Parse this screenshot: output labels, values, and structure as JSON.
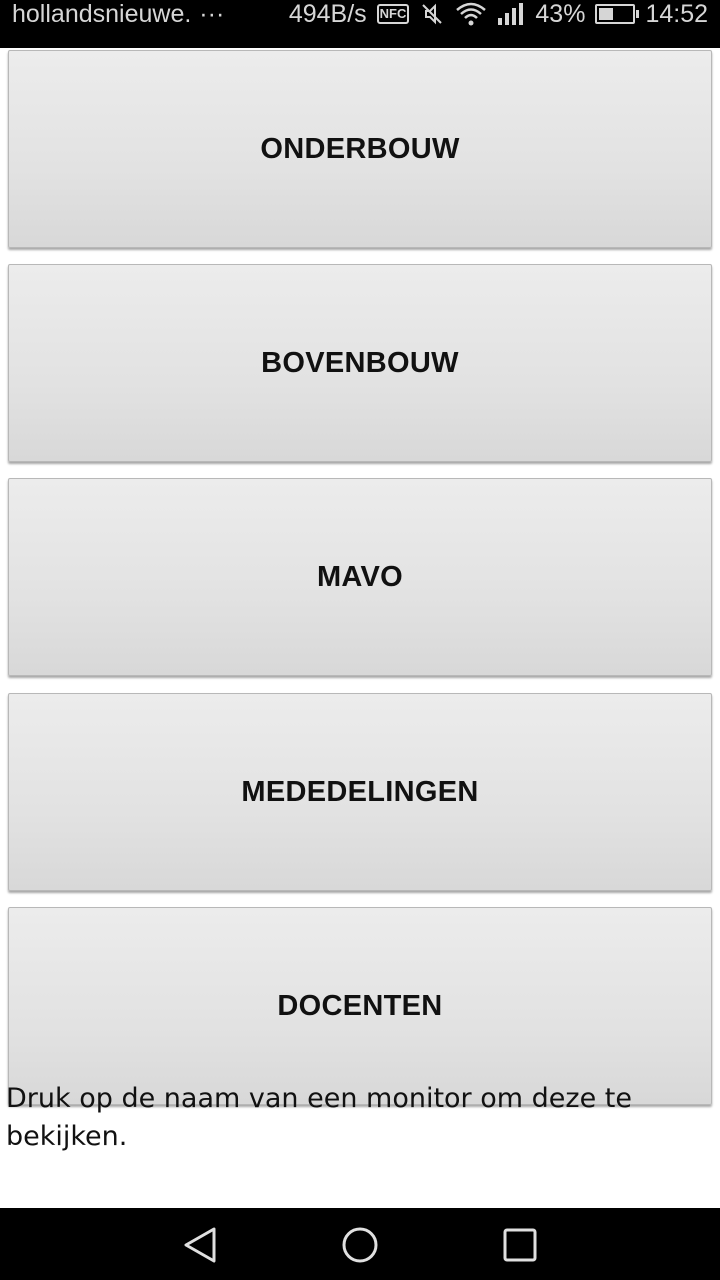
{
  "status_bar": {
    "notification_text": "hollandsnieuwe.",
    "overflow": "···",
    "net_speed": "494B/s",
    "nfc": "NFC",
    "battery": "43%",
    "time": "14:52",
    "icons": [
      "nfc-icon",
      "mute-icon",
      "wifi-icon",
      "signal-icon",
      "battery-icon"
    ]
  },
  "menu": {
    "buttons": [
      {
        "label": "ONDERBOUW"
      },
      {
        "label": "BOVENBOUW"
      },
      {
        "label": "MAVO"
      },
      {
        "label": "MEDEDELINGEN"
      },
      {
        "label": "DOCENTEN"
      }
    ]
  },
  "hint_text": "Druk op de naam van een monitor om deze te bekijken.",
  "nav_bar": {
    "icons": [
      "back-icon",
      "home-icon",
      "recents-icon"
    ]
  }
}
